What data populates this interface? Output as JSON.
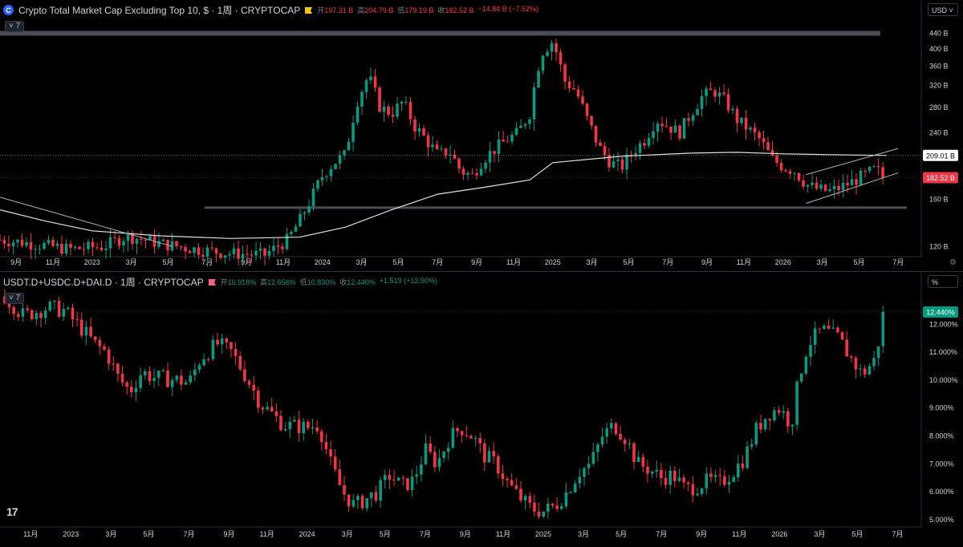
{
  "colors": {
    "up": "#089981",
    "down": "#f23645",
    "text": "#d1d4dc",
    "muted": "#787b86",
    "ma": "#e0e0e0",
    "grid": "#2a2e39",
    "badge_up": "#089981",
    "badge_down": "#f23645"
  },
  "pane1": {
    "title": "Crypto Total Market Cap Excluding Top 10, $ · 1周 · CRYPTOCAP",
    "icon": "c-coin-icon",
    "flag_icon": "yellow-flag-icon",
    "ohlc": {
      "o_label": "开",
      "o": "197.31 B",
      "h_label": "高",
      "h": "204.79 B",
      "l_label": "低",
      "l": "179.19 B",
      "c_label": "收",
      "c": "182.52 B",
      "change": "−14.84 B (−7.52%)"
    },
    "collapse_label": "7",
    "unit_label": "USD",
    "price_badges": [
      {
        "label": "209.01 B",
        "value": 209.01,
        "kind": "ma"
      },
      {
        "label": "182.52 B",
        "value": 182.52,
        "kind": "last"
      }
    ]
  },
  "pane2": {
    "title": "USDT.D+USDC.D+DAI.D · 1周 · CRYPTOCAP",
    "flag_icon": "pink-flag-icon",
    "ohlc": {
      "o_label": "开",
      "o": "10.918%",
      "h_label": "高",
      "h": "12.656%",
      "l_label": "低",
      "l": "10.830%",
      "c_label": "收",
      "c": "12.440%",
      "change": "+1.519 (+13.90%)"
    },
    "collapse_label": "7",
    "unit_label": "%",
    "price_badges": [
      {
        "label": "12.440%",
        "value": 12.44,
        "kind": "last"
      }
    ]
  },
  "chart_data": [
    {
      "type": "candlestick",
      "name": "pane1",
      "scale": "log",
      "ylim": [
        115,
        470
      ],
      "yticks": [
        {
          "v": 440,
          "label": "440 B"
        },
        {
          "v": 400,
          "label": "400 B"
        },
        {
          "v": 360,
          "label": "360 B"
        },
        {
          "v": 320,
          "label": "320 B"
        },
        {
          "v": 280,
          "label": "280 B"
        },
        {
          "v": 240,
          "label": "240 B"
        },
        {
          "v": 160,
          "label": "160 B"
        },
        {
          "v": 120,
          "label": "120 B"
        }
      ],
      "xticks": [
        {
          "t": 2022.67,
          "label": "9月"
        },
        {
          "t": 2022.83,
          "label": "11月"
        },
        {
          "t": 2023.0,
          "label": "2023"
        },
        {
          "t": 2023.17,
          "label": "3月"
        },
        {
          "t": 2023.33,
          "label": "5月"
        },
        {
          "t": 2023.5,
          "label": "7月"
        },
        {
          "t": 2023.67,
          "label": "9月"
        },
        {
          "t": 2023.83,
          "label": "11月"
        },
        {
          "t": 2024.0,
          "label": "2024"
        },
        {
          "t": 2024.17,
          "label": "3月"
        },
        {
          "t": 2024.33,
          "label": "5月"
        },
        {
          "t": 2024.5,
          "label": "7月"
        },
        {
          "t": 2024.67,
          "label": "9月"
        },
        {
          "t": 2024.83,
          "label": "11月"
        },
        {
          "t": 2025.0,
          "label": "2025"
        },
        {
          "t": 2025.17,
          "label": "3月"
        },
        {
          "t": 2025.33,
          "label": "5月"
        },
        {
          "t": 2025.5,
          "label": "7月"
        },
        {
          "t": 2025.67,
          "label": "9月"
        },
        {
          "t": 2025.83,
          "label": "11月"
        },
        {
          "t": 2026.0,
          "label": "2026"
        },
        {
          "t": 2026.17,
          "label": "3月"
        },
        {
          "t": 2026.33,
          "label": "5月"
        },
        {
          "t": 2026.5,
          "label": "7月"
        }
      ],
      "close_path": [
        [
          2022.6,
          125
        ],
        [
          2022.75,
          122
        ],
        [
          2022.9,
          118
        ],
        [
          2023.05,
          120
        ],
        [
          2023.15,
          128
        ],
        [
          2023.3,
          122
        ],
        [
          2023.45,
          118
        ],
        [
          2023.6,
          115
        ],
        [
          2023.75,
          114
        ],
        [
          2023.85,
          125
        ],
        [
          2023.9,
          140
        ],
        [
          2023.95,
          160
        ],
        [
          2024.0,
          185
        ],
        [
          2024.05,
          200
        ],
        [
          2024.1,
          210
        ],
        [
          2024.15,
          290
        ],
        [
          2024.2,
          340
        ],
        [
          2024.25,
          280
        ],
        [
          2024.3,
          270
        ],
        [
          2024.35,
          290
        ],
        [
          2024.4,
          250
        ],
        [
          2024.5,
          210
        ],
        [
          2024.55,
          215
        ],
        [
          2024.6,
          190
        ],
        [
          2024.65,
          185
        ],
        [
          2024.7,
          205
        ],
        [
          2024.8,
          230
        ],
        [
          2024.85,
          240
        ],
        [
          2024.9,
          270
        ],
        [
          2024.95,
          390
        ],
        [
          2025.0,
          420
        ],
        [
          2025.05,
          330
        ],
        [
          2025.1,
          310
        ],
        [
          2025.15,
          260
        ],
        [
          2025.2,
          220
        ],
        [
          2025.25,
          200
        ],
        [
          2025.3,
          195
        ],
        [
          2025.35,
          215
        ],
        [
          2025.4,
          230
        ],
        [
          2025.45,
          260
        ],
        [
          2025.5,
          250
        ],
        [
          2025.55,
          240
        ],
        [
          2025.6,
          270
        ],
        [
          2025.65,
          300
        ],
        [
          2025.7,
          310
        ],
        [
          2025.75,
          290
        ],
        [
          2025.8,
          260
        ],
        [
          2025.85,
          245
        ],
        [
          2025.9,
          230
        ],
        [
          2025.95,
          205
        ],
        [
          2026.0,
          195
        ],
        [
          2026.05,
          190
        ],
        [
          2026.1,
          175
        ],
        [
          2026.15,
          170
        ],
        [
          2026.2,
          168
        ],
        [
          2026.25,
          172
        ],
        [
          2026.3,
          178
        ],
        [
          2026.35,
          185
        ],
        [
          2026.4,
          192
        ],
        [
          2026.45,
          182.52
        ]
      ],
      "moving_average": [
        [
          2022.6,
          150
        ],
        [
          2022.8,
          140
        ],
        [
          2023.0,
          132
        ],
        [
          2023.3,
          128
        ],
        [
          2023.6,
          126
        ],
        [
          2023.9,
          127
        ],
        [
          2024.1,
          135
        ],
        [
          2024.3,
          150
        ],
        [
          2024.5,
          165
        ],
        [
          2024.7,
          172
        ],
        [
          2024.9,
          180
        ],
        [
          2025.0,
          200
        ],
        [
          2025.3,
          208
        ],
        [
          2025.6,
          212
        ],
        [
          2025.8,
          213
        ],
        [
          2026.0,
          211
        ],
        [
          2026.2,
          210
        ],
        [
          2026.45,
          209.01
        ]
      ],
      "hlines": [
        440,
        152
      ]
    },
    {
      "type": "candlestick",
      "name": "pane2",
      "scale": "linear",
      "ylim": [
        4.8,
        13.3
      ],
      "yticks": [
        {
          "v": 12,
          "label": "12.000%"
        },
        {
          "v": 11,
          "label": "11.000%"
        },
        {
          "v": 10,
          "label": "10.000%"
        },
        {
          "v": 9,
          "label": "9.000%"
        },
        {
          "v": 8,
          "label": "8.000%"
        },
        {
          "v": 7,
          "label": "7.000%"
        },
        {
          "v": 6,
          "label": "6.000%"
        },
        {
          "v": 5,
          "label": "5.000%"
        }
      ],
      "xticks": [
        {
          "t": 2022.83,
          "label": "11月"
        },
        {
          "t": 2023.0,
          "label": "2023"
        },
        {
          "t": 2023.17,
          "label": "3月"
        },
        {
          "t": 2023.33,
          "label": "5月"
        },
        {
          "t": 2023.5,
          "label": "7月"
        },
        {
          "t": 2023.67,
          "label": "9月"
        },
        {
          "t": 2023.83,
          "label": "11月"
        },
        {
          "t": 2024.0,
          "label": "2024"
        },
        {
          "t": 2024.17,
          "label": "3月"
        },
        {
          "t": 2024.33,
          "label": "5月"
        },
        {
          "t": 2024.5,
          "label": "7月"
        },
        {
          "t": 2024.67,
          "label": "9月"
        },
        {
          "t": 2024.83,
          "label": "11月"
        },
        {
          "t": 2025.0,
          "label": "2025"
        },
        {
          "t": 2025.17,
          "label": "3月"
        },
        {
          "t": 2025.33,
          "label": "5月"
        },
        {
          "t": 2025.5,
          "label": "7月"
        },
        {
          "t": 2025.67,
          "label": "9月"
        },
        {
          "t": 2025.83,
          "label": "11月"
        },
        {
          "t": 2026.0,
          "label": "2026"
        },
        {
          "t": 2026.17,
          "label": "3月"
        },
        {
          "t": 2026.33,
          "label": "5月"
        },
        {
          "t": 2026.5,
          "label": "7月"
        }
      ],
      "close_path": [
        [
          2022.72,
          13.0
        ],
        [
          2022.8,
          12.3
        ],
        [
          2022.9,
          12.6
        ],
        [
          2022.97,
          12.5
        ],
        [
          2023.05,
          11.8
        ],
        [
          2023.1,
          11.3
        ],
        [
          2023.15,
          11.0
        ],
        [
          2023.2,
          10.1
        ],
        [
          2023.25,
          9.6
        ],
        [
          2023.3,
          10.3
        ],
        [
          2023.35,
          10.1
        ],
        [
          2023.45,
          10.0
        ],
        [
          2023.5,
          9.9
        ],
        [
          2023.55,
          10.8
        ],
        [
          2023.62,
          11.3
        ],
        [
          2023.68,
          11.0
        ],
        [
          2023.75,
          10.0
        ],
        [
          2023.8,
          9.2
        ],
        [
          2023.85,
          8.8
        ],
        [
          2023.9,
          8.4
        ],
        [
          2024.0,
          8.3
        ],
        [
          2024.05,
          8.4
        ],
        [
          2024.1,
          7.0
        ],
        [
          2024.15,
          6.0
        ],
        [
          2024.2,
          5.5
        ],
        [
          2024.3,
          6.0
        ],
        [
          2024.35,
          6.6
        ],
        [
          2024.4,
          6.2
        ],
        [
          2024.45,
          6.4
        ],
        [
          2024.5,
          7.5
        ],
        [
          2024.55,
          7.0
        ],
        [
          2024.6,
          7.9
        ],
        [
          2024.65,
          8.3
        ],
        [
          2024.7,
          8.0
        ],
        [
          2024.75,
          7.3
        ],
        [
          2024.8,
          7.0
        ],
        [
          2024.85,
          6.3
        ],
        [
          2024.9,
          5.8
        ],
        [
          2024.95,
          5.4
        ],
        [
          2025.0,
          5.3
        ],
        [
          2025.05,
          5.5
        ],
        [
          2025.1,
          6.0
        ],
        [
          2025.15,
          6.7
        ],
        [
          2025.2,
          7.0
        ],
        [
          2025.25,
          8.0
        ],
        [
          2025.3,
          8.4
        ],
        [
          2025.35,
          7.9
        ],
        [
          2025.4,
          7.0
        ],
        [
          2025.45,
          6.8
        ],
        [
          2025.5,
          6.5
        ],
        [
          2025.55,
          6.6
        ],
        [
          2025.6,
          6.1
        ],
        [
          2025.65,
          6.2
        ],
        [
          2025.7,
          6.4
        ],
        [
          2025.75,
          6.3
        ],
        [
          2025.8,
          6.7
        ],
        [
          2025.85,
          7.2
        ],
        [
          2025.9,
          8.2
        ],
        [
          2025.95,
          8.8
        ],
        [
          2026.0,
          9.0
        ],
        [
          2026.05,
          8.4
        ],
        [
          2026.08,
          10.0
        ],
        [
          2026.12,
          11.3
        ],
        [
          2026.18,
          11.8
        ],
        [
          2026.25,
          11.5
        ],
        [
          2026.3,
          10.8
        ],
        [
          2026.35,
          10.2
        ],
        [
          2026.4,
          10.7
        ],
        [
          2026.45,
          12.44
        ]
      ]
    }
  ]
}
